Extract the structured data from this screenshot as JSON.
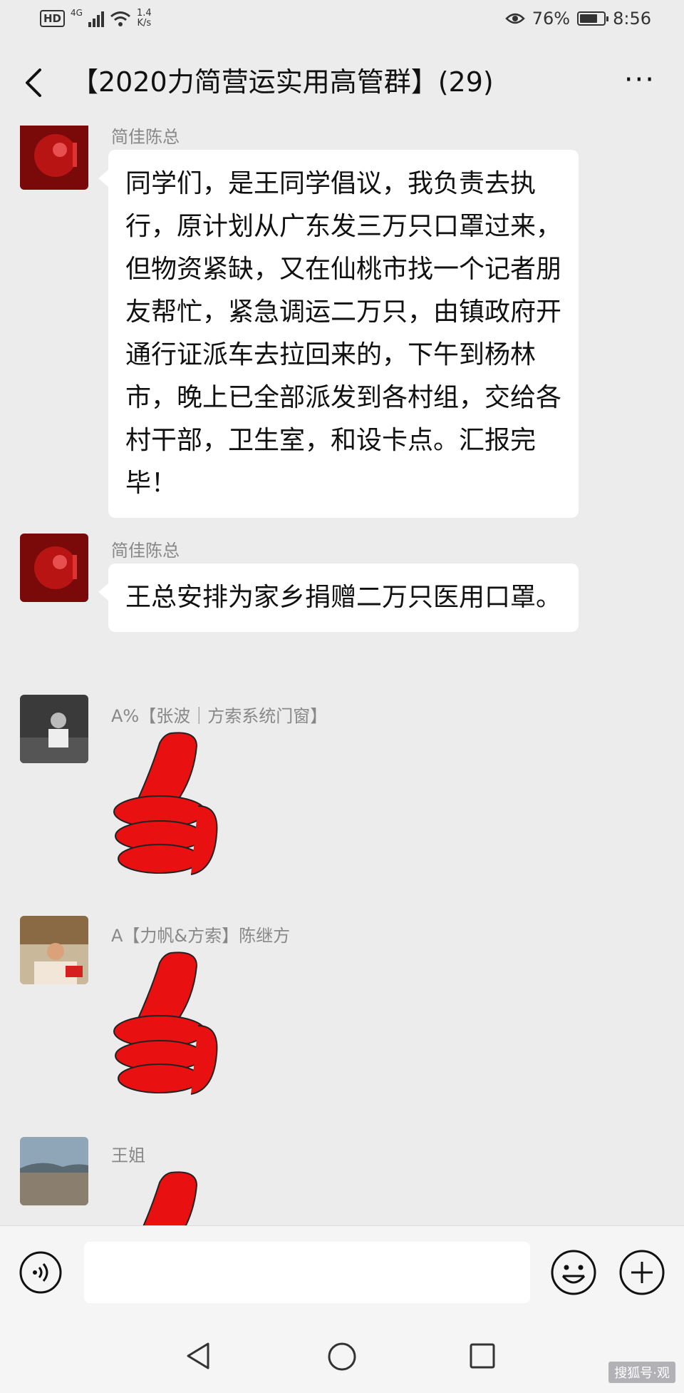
{
  "status_bar": {
    "hd": "HD",
    "network": "4G",
    "speed_value": "1.4",
    "speed_unit": "K/s",
    "battery": "76%",
    "battery_level": 0.76,
    "time": "8:56"
  },
  "header": {
    "title": "【2020力简营运实用高管群】(29)",
    "more_label": "···"
  },
  "messages": [
    {
      "sender": "简佳陈总",
      "type": "text",
      "text": "同学们，是王同学倡议，我负责去执行，原计划从广东发三万只口罩过来，但物资紧缺，又在仙桃市找一个记者朋友帮忙，紧急调运二万只，由镇政府开通行证派车去拉回来的，下午到杨林市，晚上已全部派发到各村组，交给各村干部，卫生室，和设卡点。汇报完毕！"
    },
    {
      "sender": "简佳陈总",
      "type": "text",
      "text": "王总安排为家乡捐赠二万只医用口罩。"
    },
    {
      "sender": "A%【张波｜方索系统门窗】",
      "type": "sticker",
      "sticker": "thumbs-up"
    },
    {
      "sender": "A【力帆&方索】陈继方",
      "type": "sticker",
      "sticker": "thumbs-up"
    },
    {
      "sender": "王姐",
      "type": "sticker",
      "sticker": "thumbs-up"
    }
  ],
  "input_bar": {
    "placeholder": "",
    "value": ""
  },
  "colors": {
    "background": "#ececec",
    "bubble": "#ffffff",
    "sticker_red": "#e81010",
    "sender_text": "#888888"
  },
  "icons": [
    "back-arrow-icon",
    "more-icon",
    "voice-icon",
    "emoji-icon",
    "plus-icon",
    "nav-back-icon",
    "nav-home-icon",
    "nav-recent-icon"
  ],
  "watermark": "搜狐号·观"
}
